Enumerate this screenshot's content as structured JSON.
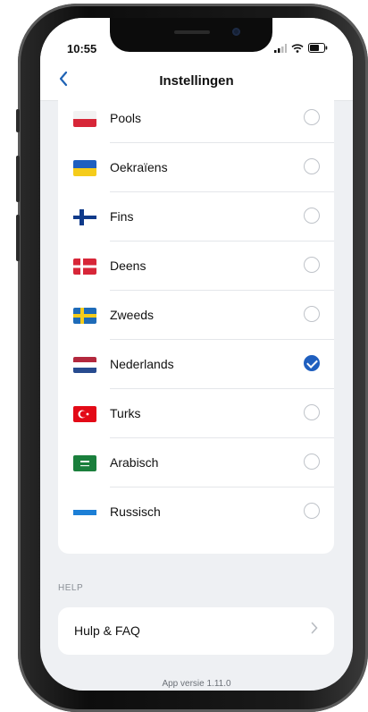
{
  "status": {
    "time": "10:55"
  },
  "nav": {
    "back_icon": "chevron-left-icon",
    "title": "Instellingen"
  },
  "languages": [
    {
      "label": "Pools",
      "flag": "poland-flag-icon",
      "selected": false
    },
    {
      "label": "Oekraïens",
      "flag": "ukraine-flag-icon",
      "selected": false
    },
    {
      "label": "Fins",
      "flag": "finland-flag-icon",
      "selected": false
    },
    {
      "label": "Deens",
      "flag": "denmark-flag-icon",
      "selected": false
    },
    {
      "label": "Zweeds",
      "flag": "sweden-flag-icon",
      "selected": false
    },
    {
      "label": "Nederlands",
      "flag": "netherlands-flag-icon",
      "selected": true
    },
    {
      "label": "Turks",
      "flag": "turkey-flag-icon",
      "selected": false
    },
    {
      "label": "Arabisch",
      "flag": "saudi-arabia-flag-icon",
      "selected": false
    },
    {
      "label": "Russisch",
      "flag": "russia-flag-icon",
      "selected": false
    }
  ],
  "help": {
    "section_label": "HELP",
    "faq_label": "Hulp & FAQ",
    "chevron_icon": "chevron-right-icon"
  },
  "footer": {
    "version": "App versie 1.11.0"
  },
  "colors": {
    "accent": "#1f5fbf",
    "background": "#eef0f3"
  }
}
